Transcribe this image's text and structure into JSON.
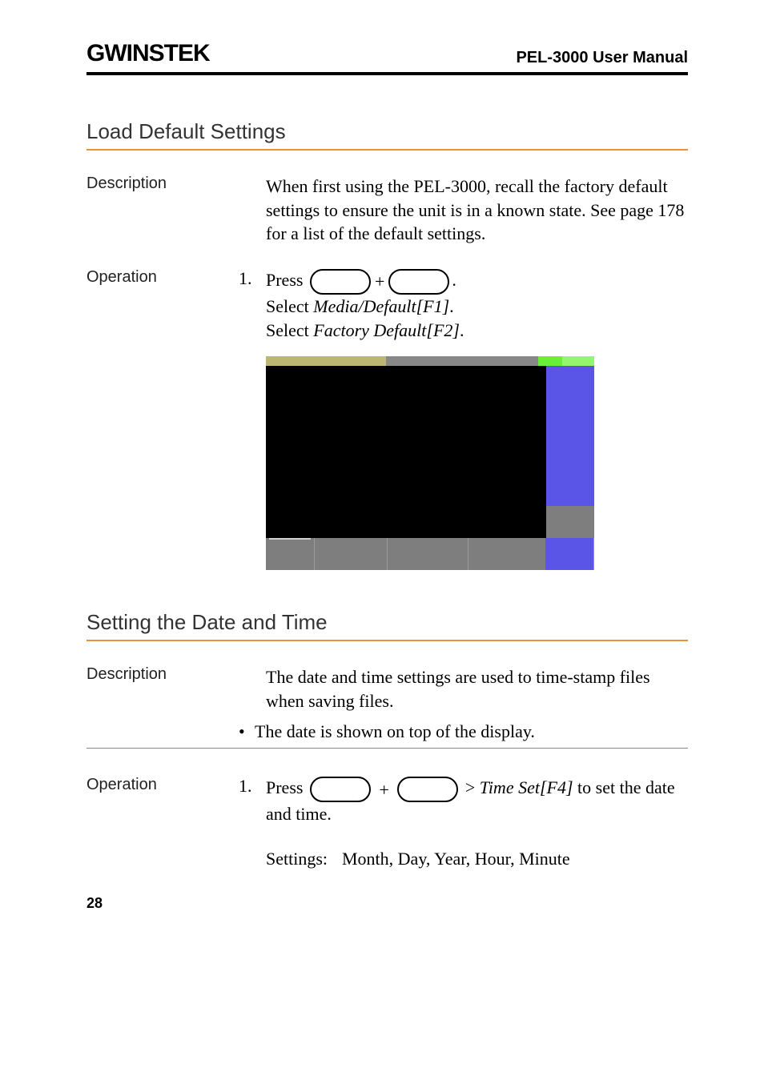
{
  "header": {
    "logo_text": "GWINSTEK",
    "manual_title": "PEL-3000 User Manual"
  },
  "section1": {
    "title": "Load Default Settings",
    "desc_label": "Description",
    "desc_text": "When first using the PEL-3000, recall the factory default settings to ensure the unit is in a known state. See page 178 for a list of the default settings.",
    "op_label": "Operation",
    "step_num": "1.",
    "press": "Press",
    "period": ".",
    "select1_a": "Select ",
    "select1_b": "Media/Default[F1]",
    "select1_c": ".",
    "select2_a": "Select ",
    "select2_b": "Factory Default[F2]",
    "select2_c": "."
  },
  "section2": {
    "title": "Setting the Date and Time",
    "desc_label": "Description",
    "desc_text": "The date and time settings are used to time-stamp files when saving files.",
    "bullet": "The date is shown on top of the display.",
    "op_label": "Operation",
    "step_num": "1.",
    "press": "Press",
    "gt": " > ",
    "timeset": "Time Set[F4]",
    "tail": " to set the date and time.",
    "settings_label": "Settings:",
    "settings_values": "Month, Day, Year, Hour, Minute"
  },
  "page_number": "28"
}
